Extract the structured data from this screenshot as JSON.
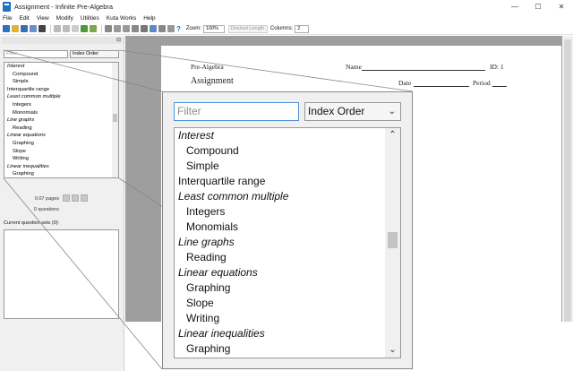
{
  "window": {
    "title": "Assignment - Infinite Pre-Algebra",
    "minimize": "—",
    "maximize": "☐",
    "close": "✕"
  },
  "menu": [
    "File",
    "Edit",
    "View",
    "Modify",
    "Utilities",
    "Kuta Works",
    "Help"
  ],
  "toolbar": {
    "zoom_label": "Zoom:",
    "zoom_value": "100%",
    "desired_length": "Desired Length",
    "columns_label": "Columns:",
    "columns_value": "2",
    "help": "?"
  },
  "sidebar": {
    "filter_placeholder": "Filter",
    "order_value": "Index Order",
    "pages_info": "0.07 pages",
    "questions_info": "0 questions",
    "current_label": "Current question sets (0):",
    "pin": "⊟"
  },
  "topics": [
    {
      "label": "Interest",
      "kind": "cat"
    },
    {
      "label": "Compound",
      "kind": "sub"
    },
    {
      "label": "Simple",
      "kind": "sub"
    },
    {
      "label": "Interquartile range",
      "kind": "top"
    },
    {
      "label": "Least common multiple",
      "kind": "cat"
    },
    {
      "label": "Integers",
      "kind": "sub"
    },
    {
      "label": "Monomials",
      "kind": "sub"
    },
    {
      "label": "Line graphs",
      "kind": "cat"
    },
    {
      "label": "Reading",
      "kind": "sub"
    },
    {
      "label": "Linear equations",
      "kind": "cat"
    },
    {
      "label": "Graphing",
      "kind": "sub"
    },
    {
      "label": "Slope",
      "kind": "sub"
    },
    {
      "label": "Writing",
      "kind": "sub"
    },
    {
      "label": "Linear inequalities",
      "kind": "cat"
    },
    {
      "label": "Graphing",
      "kind": "sub"
    }
  ],
  "document": {
    "subject": "Pre-Algebra",
    "title": "Assignment",
    "name_label": "Name",
    "id_label": "ID: 1",
    "date_label": "Date",
    "period_label": "Period"
  },
  "zoom_popup": {
    "filter_placeholder": "Filter",
    "order_value": "Index Order",
    "caret": "⌄",
    "up": "⌃",
    "down": "⌄"
  }
}
